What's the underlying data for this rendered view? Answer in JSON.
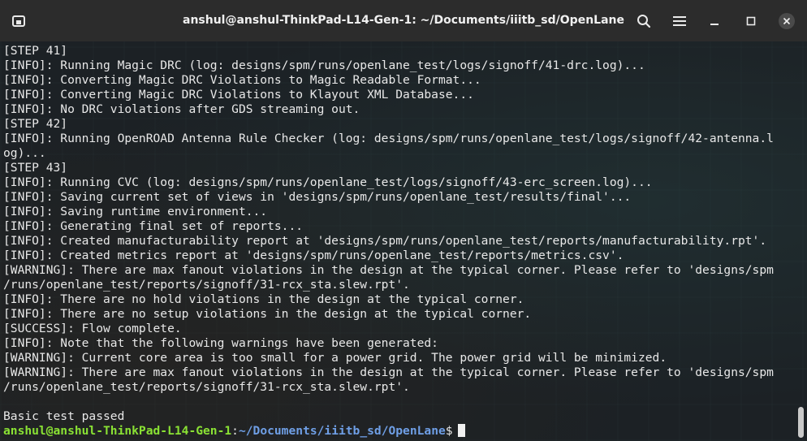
{
  "window": {
    "title": "anshul@anshul-ThinkPad-L14-Gen-1: ~/Documents/iiitb_sd/OpenLane",
    "icons": {
      "new_tab": "new-tab-icon",
      "search": "search-icon",
      "menu": "hamburger-menu-icon",
      "minimize": "minimize-icon",
      "maximize": "maximize-icon",
      "close": "close-icon"
    }
  },
  "terminal": {
    "lines": [
      "[STEP 41]",
      "[INFO]: Running Magic DRC (log: designs/spm/runs/openlane_test/logs/signoff/41-drc.log)...",
      "[INFO]: Converting Magic DRC Violations to Magic Readable Format...",
      "[INFO]: Converting Magic DRC Violations to Klayout XML Database...",
      "[INFO]: No DRC violations after GDS streaming out.",
      "[STEP 42]",
      "[INFO]: Running OpenROAD Antenna Rule Checker (log: designs/spm/runs/openlane_test/logs/signoff/42-antenna.l",
      "og)...",
      "[STEP 43]",
      "[INFO]: Running CVC (log: designs/spm/runs/openlane_test/logs/signoff/43-erc_screen.log)...",
      "[INFO]: Saving current set of views in 'designs/spm/runs/openlane_test/results/final'...",
      "[INFO]: Saving runtime environment...",
      "[INFO]: Generating final set of reports...",
      "[INFO]: Created manufacturability report at 'designs/spm/runs/openlane_test/reports/manufacturability.rpt'.",
      "[INFO]: Created metrics report at 'designs/spm/runs/openlane_test/reports/metrics.csv'.",
      "[WARNING]: There are max fanout violations in the design at the typical corner. Please refer to 'designs/spm",
      "/runs/openlane_test/reports/signoff/31-rcx_sta.slew.rpt'.",
      "[INFO]: There are no hold violations in the design at the typical corner.",
      "[INFO]: There are no setup violations in the design at the typical corner.",
      "[SUCCESS]: Flow complete.",
      "[INFO]: Note that the following warnings have been generated:",
      "[WARNING]: Current core area is too small for a power grid. The power grid will be minimized.",
      "[WARNING]: There are max fanout violations in the design at the typical corner. Please refer to 'designs/spm",
      "/runs/openlane_test/reports/signoff/31-rcx_sta.slew.rpt'.",
      "",
      "Basic test passed"
    ],
    "prompt": {
      "user_host": "anshul@anshul-ThinkPad-L14-Gen-1",
      "separator": ":",
      "path": "~/Documents/iiitb_sd/OpenLane",
      "symbol": "$"
    }
  },
  "colors": {
    "prompt_user": "#8ae234",
    "prompt_path": "#6f9fe6",
    "text": "#e8e8e8",
    "titlebar": "#2c2c2c"
  }
}
